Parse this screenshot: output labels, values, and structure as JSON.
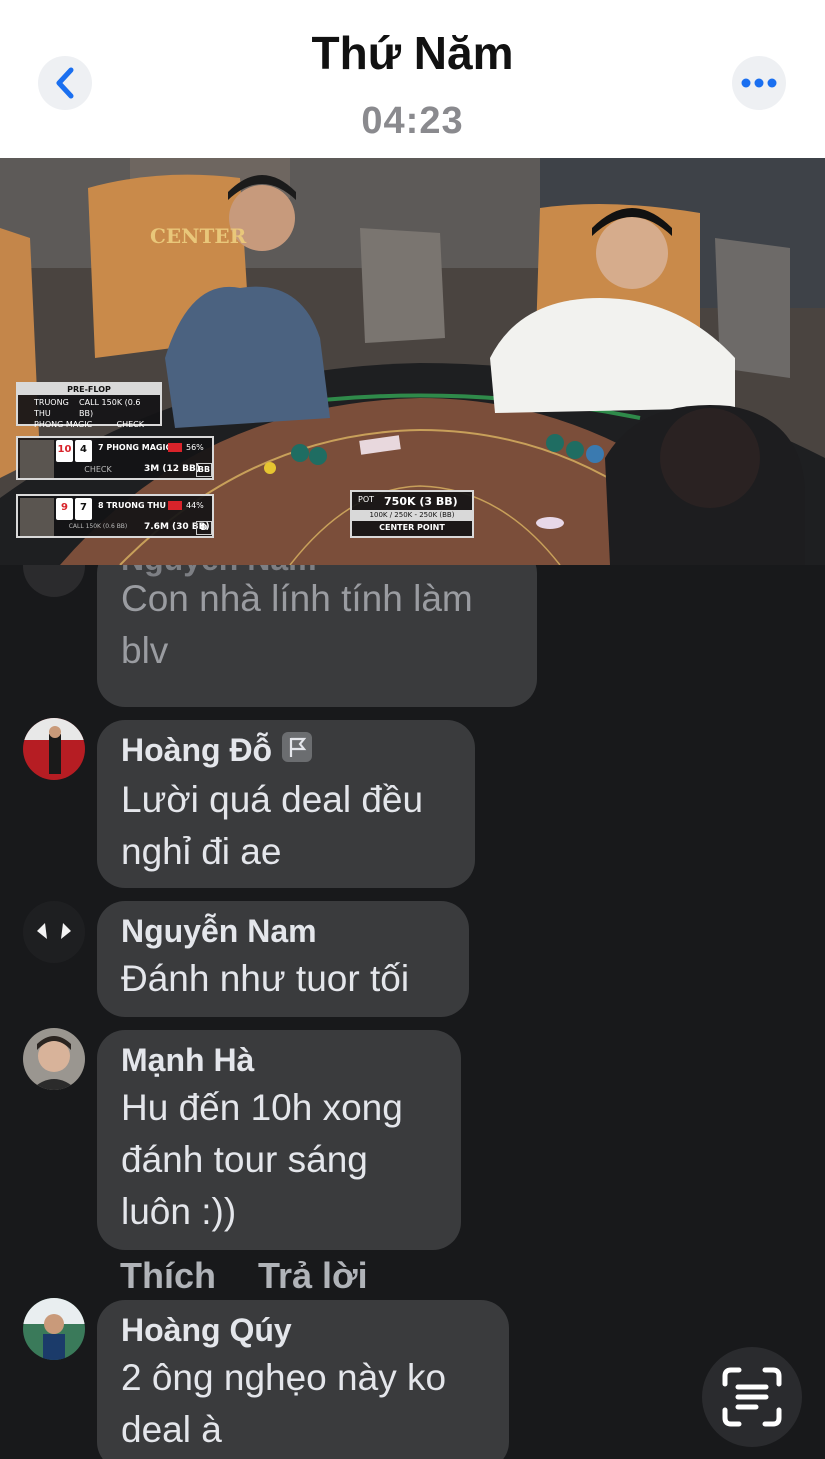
{
  "header": {
    "title": "Thứ Năm",
    "time": "04:23"
  },
  "video": {
    "hud": {
      "stage": "PRE-FLOP",
      "history": [
        {
          "player": "TRUONG THU",
          "action": "CALL 150K (0.6 BB)"
        },
        {
          "player": "PHONG MAGIC",
          "action": "CHECK"
        }
      ],
      "players": [
        {
          "cards": [
            "10",
            "4"
          ],
          "card_colors": [
            "red",
            "black"
          ],
          "name": "7 PHONG MAGIC",
          "equity": "56%",
          "action": "CHECK",
          "stack": "3M (12 BB)",
          "position": "BB"
        },
        {
          "cards": [
            "9",
            "7"
          ],
          "card_colors": [
            "red",
            "black"
          ],
          "name": "8 TRUONG THU",
          "equity": "44%",
          "action": "CALL 150K (0.6 BB)",
          "stack": "7.6M (30 BB)",
          "position": "D"
        }
      ],
      "pot_label": "POT",
      "pot_value": "750K (3 BB)",
      "blinds": "100K / 250K - 250K (BB)",
      "venue": "CENTER POINT"
    },
    "chair_logo": "CENTER"
  },
  "comments": [
    {
      "author": "Nguyễn Nam",
      "text_lines": [
        "Con nhà lính tính làm",
        "blv"
      ]
    },
    {
      "author": "Hoàng Đỗ",
      "text_lines": [
        "Lười quá deal đều",
        "nghỉ đi ae"
      ]
    },
    {
      "author": "Nguyễn Nam",
      "text_lines": [
        "Đánh như tuor tối"
      ]
    },
    {
      "author": "Mạnh Hà",
      "text_lines": [
        "Hu đến 10h xong",
        "đánh tour sáng",
        "luôn :))"
      ]
    },
    {
      "author": "Hoàng Qúy",
      "text_lines": [
        "2 ông nghẹo này ko",
        "deal à"
      ]
    }
  ],
  "comment_actions": {
    "like": "Thích",
    "reply": "Trả lời"
  },
  "icons": {
    "back": "chevron-left-icon",
    "more": "more-horizontal-icon",
    "badge": "flag-badge-icon",
    "scan": "text-scan-icon"
  },
  "colors": {
    "accent": "#1a6ff0",
    "bubble": "#3a3b3d",
    "background": "#18191b"
  }
}
